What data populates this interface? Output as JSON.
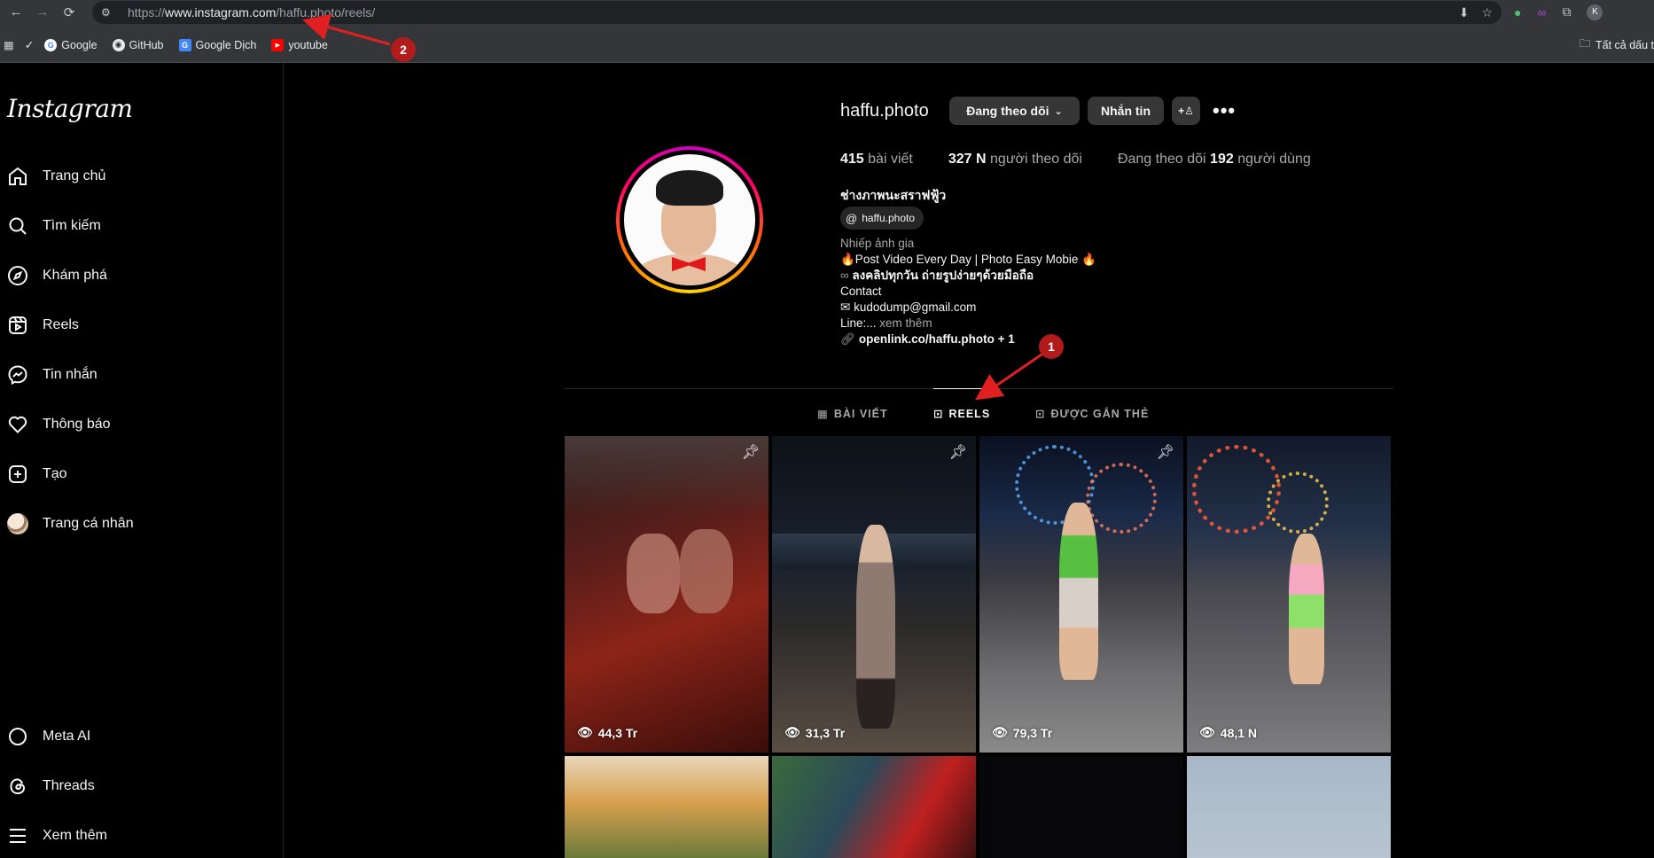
{
  "browser": {
    "url_scheme": "https://",
    "url_host": "www.instagram.com",
    "url_path": "/haffu.photo/reels/",
    "profile_initial": "K",
    "bookmarks": [
      {
        "label": "Google",
        "icon": "google-icon"
      },
      {
        "label": "GitHub",
        "icon": "github-icon"
      },
      {
        "label": "Google Dịch",
        "icon": "google-translate-icon"
      },
      {
        "label": "youtube",
        "icon": "youtube-icon"
      }
    ],
    "all_bookmarks_label": "Tất cả dấu t"
  },
  "sidebar": {
    "logo": "Instagram",
    "items": [
      {
        "label": "Trang chủ",
        "icon": "home-icon"
      },
      {
        "label": "Tìm kiếm",
        "icon": "search-icon"
      },
      {
        "label": "Khám phá",
        "icon": "compass-icon"
      },
      {
        "label": "Reels",
        "icon": "reels-icon"
      },
      {
        "label": "Tin nhắn",
        "icon": "messenger-icon"
      },
      {
        "label": "Thông báo",
        "icon": "heart-icon"
      },
      {
        "label": "Tạo",
        "icon": "plus-square-icon"
      },
      {
        "label": "Trang cá nhân",
        "icon": "avatar"
      }
    ],
    "bottom_items": [
      {
        "label": "Meta AI",
        "icon": "meta-ai-icon"
      },
      {
        "label": "Threads",
        "icon": "threads-icon"
      },
      {
        "label": "Xem thêm",
        "icon": "menu-icon"
      }
    ]
  },
  "profile": {
    "username": "haffu.photo",
    "following_button": "Đang theo dõi",
    "message_button": "Nhắn tin",
    "posts_count": "415",
    "posts_label": "bài viết",
    "followers_count": "327 N",
    "followers_label": "người theo dõi",
    "following_prefix": "Đang theo dõi",
    "following_count": "192",
    "following_suffix": "người dùng",
    "full_name": "ช่างภาพนะสราฟฟู้ว",
    "threads_handle": "haffu.photo",
    "category": "Nhiếp ảnh gia",
    "bio_line1": "🔥Post Video Every Day | Photo Easy Mobie 🔥",
    "bio_line2": "ลงคลิปทุกวัน ถ่ายรูปง่ายๆด้วยมือถือ",
    "bio_line3": "Contact",
    "bio_line4": "kudodump@gmail.com",
    "bio_line5_start": "Line:...",
    "bio_more": "xem thêm",
    "link": "openlink.co/haffu.photo + 1"
  },
  "tabs": [
    {
      "label": "BÀI VIẾT",
      "active": false
    },
    {
      "label": "REELS",
      "active": true
    },
    {
      "label": "ĐƯỢC GẮN THẺ",
      "active": false
    }
  ],
  "reels": [
    {
      "views": "44,3 Tr",
      "pinned": true
    },
    {
      "views": "31,3 Tr",
      "pinned": true
    },
    {
      "views": "79,3 Tr",
      "pinned": true
    },
    {
      "views": "48,1 N",
      "pinned": false
    }
  ],
  "annotations": [
    {
      "number": "1"
    },
    {
      "number": "2"
    }
  ],
  "colors": {
    "accent_annotation": "#b21b1b",
    "background": "#000000",
    "button": "#363636"
  }
}
